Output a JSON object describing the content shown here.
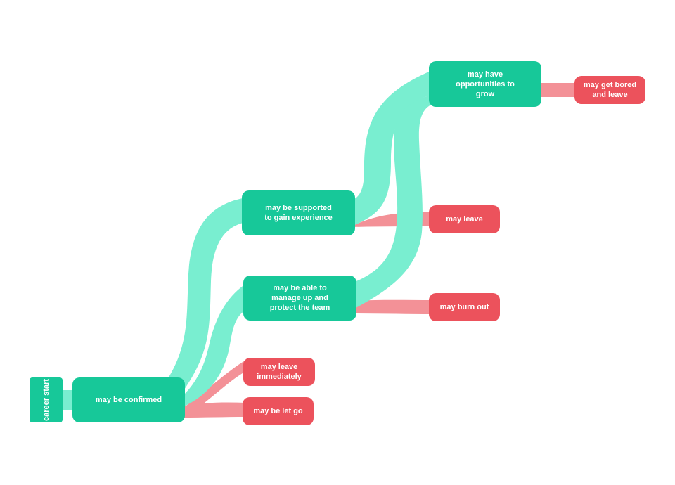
{
  "colors": {
    "positive_node": "#17c899",
    "negative_node": "#ec525c",
    "positive_flow": "#79eed0",
    "negative_flow": "#f39197"
  },
  "nodes": [
    {
      "id": "career-start",
      "label": "career\nstart",
      "type": "positive"
    },
    {
      "id": "confirmed",
      "label": "may be confirmed",
      "type": "positive"
    },
    {
      "id": "supported",
      "label": "may be supported\nto gain experience",
      "type": "positive"
    },
    {
      "id": "manage-up",
      "label": "may be able to\nmanage up and\nprotect the team",
      "type": "positive"
    },
    {
      "id": "leave-immediately",
      "label": "may leave\nimmediately",
      "type": "negative"
    },
    {
      "id": "let-go",
      "label": "may be let go",
      "type": "negative"
    },
    {
      "id": "opportunities",
      "label": "may have\nopportunities to\ngrow",
      "type": "positive"
    },
    {
      "id": "leave",
      "label": "may leave",
      "type": "negative"
    },
    {
      "id": "burn-out",
      "label": "may burn out",
      "type": "negative"
    },
    {
      "id": "bored",
      "label": "may get bored\nand leave",
      "type": "negative"
    }
  ],
  "links": [
    {
      "from": "career-start",
      "to": "confirmed",
      "type": "positive"
    },
    {
      "from": "confirmed",
      "to": "supported",
      "type": "positive"
    },
    {
      "from": "confirmed",
      "to": "manage-up",
      "type": "positive"
    },
    {
      "from": "confirmed",
      "to": "leave-immediately",
      "type": "negative"
    },
    {
      "from": "confirmed",
      "to": "let-go",
      "type": "negative"
    },
    {
      "from": "supported",
      "to": "opportunities",
      "type": "positive"
    },
    {
      "from": "supported",
      "to": "leave",
      "type": "negative"
    },
    {
      "from": "manage-up",
      "to": "opportunities",
      "type": "positive"
    },
    {
      "from": "manage-up",
      "to": "burn-out",
      "type": "negative"
    },
    {
      "from": "opportunities",
      "to": "bored",
      "type": "negative"
    }
  ]
}
